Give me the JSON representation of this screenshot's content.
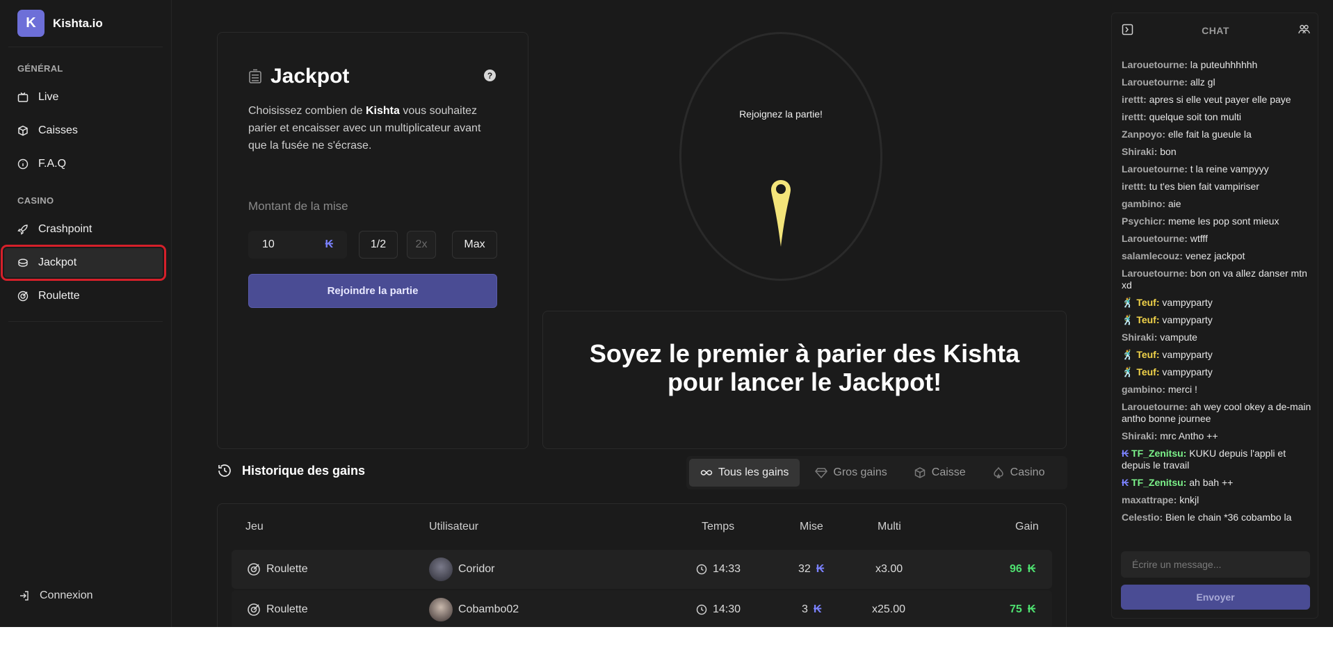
{
  "app": {
    "name": "Kishta.io",
    "logo_letter": "K"
  },
  "sidebar": {
    "section_general": "GÉNÉRAL",
    "general_items": [
      {
        "label": "Live",
        "icon": "tv-icon"
      },
      {
        "label": "Caisses",
        "icon": "box-icon"
      },
      {
        "label": "F.A.Q",
        "icon": "info-icon"
      }
    ],
    "section_casino": "CASINO",
    "casino_items": [
      {
        "label": "Crashpoint",
        "icon": "rocket-icon"
      },
      {
        "label": "Jackpot",
        "icon": "coin-stack-icon",
        "active": true
      },
      {
        "label": "Roulette",
        "icon": "target-icon"
      }
    ],
    "login_label": "Connexion"
  },
  "jackpot": {
    "title": "Jackpot",
    "help": "?",
    "desc_1": "Choisissez combien de ",
    "desc_bold": "Kishta",
    "desc_2": " vous souhaitez parier et encaisser avec un multiplicateur avant que la fusée ne s'écrase.",
    "bet_label": "Montant de la mise",
    "bet_value": "10",
    "currency": "₭",
    "half_label": "1/2",
    "double_label": "2x",
    "max_label": "Max",
    "join_label": "Rejoindre la partie"
  },
  "wheel": {
    "text": "Rejoignez la partie!"
  },
  "info": {
    "line1": "Soyez le premier à parier des Kishta",
    "line2": "pour lancer le Jackpot!"
  },
  "history": {
    "title": "Historique des gains",
    "tabs": [
      {
        "label": "Tous les gains",
        "active": true
      },
      {
        "label": "Gros gains"
      },
      {
        "label": "Caisse"
      },
      {
        "label": "Casino"
      }
    ],
    "columns": {
      "game": "Jeu",
      "user": "Utilisateur",
      "time": "Temps",
      "bet": "Mise",
      "multi": "Multi",
      "gain": "Gain"
    },
    "rows": [
      {
        "game": "Roulette",
        "user": "Coridor",
        "time": "14:33",
        "bet": "32",
        "multi": "x3.00",
        "gain": "96"
      },
      {
        "game": "Roulette",
        "user": "Cobambo02",
        "time": "14:30",
        "bet": "3",
        "multi": "x25.00",
        "gain": "75"
      }
    ]
  },
  "chat": {
    "title": "CHAT",
    "placeholder": "Écrire un message...",
    "send_label": "Envoyer",
    "messages": [
      {
        "user": "Larouetourne:",
        "text": "la puteuhhhhhh"
      },
      {
        "user": "Larouetourne:",
        "text": "allz gl"
      },
      {
        "user": "irettt:",
        "text": "apres si elle veut payer elle paye"
      },
      {
        "user": "irettt:",
        "text": "quelque soit ton multi"
      },
      {
        "user": "Zanpoyo:",
        "text": "elle fait la gueule la"
      },
      {
        "user": "Shiraki:",
        "text": "bon"
      },
      {
        "user": "Larouetourne:",
        "text": "t la reine vampyyy"
      },
      {
        "user": "irettt:",
        "text": "tu t'es bien fait vampiriser"
      },
      {
        "user": "gambino:",
        "text": "aie"
      },
      {
        "user": "Psychicr:",
        "text": "meme les pop sont mieux"
      },
      {
        "user": "Larouetourne:",
        "text": "wtfff"
      },
      {
        "user": "salamlecouz:",
        "text": "venez jackpot"
      },
      {
        "user": "Larouetourne:",
        "text": "bon on va allez danser mtn xd"
      },
      {
        "user": "Teuf:",
        "text": "vampyparty",
        "style": "yel"
      },
      {
        "user": "Teuf:",
        "text": "vampyparty",
        "style": "yel"
      },
      {
        "user": "Shiraki:",
        "text": "vampute"
      },
      {
        "user": "Teuf:",
        "text": "vampyparty",
        "style": "yel"
      },
      {
        "user": "Teuf:",
        "text": "vampyparty",
        "style": "yel"
      },
      {
        "user": "gambino:",
        "text": "merci !"
      },
      {
        "user": "Larouetourne:",
        "text": "ah wey cool okey a de-main antho bonne journee"
      },
      {
        "user": "Shiraki:",
        "text": "mrc Antho ++"
      },
      {
        "user": "TF_Zenitsu:",
        "text": "KUKU depuis l'appli et depuis le travail",
        "style": "grn"
      },
      {
        "user": "TF_Zenitsu:",
        "text": "ah bah ++",
        "style": "grn"
      },
      {
        "user": "maxattrape:",
        "text": "knkjl"
      },
      {
        "user": "Celestio:",
        "text": "Bien le chain *36 cobambo la"
      }
    ]
  }
}
